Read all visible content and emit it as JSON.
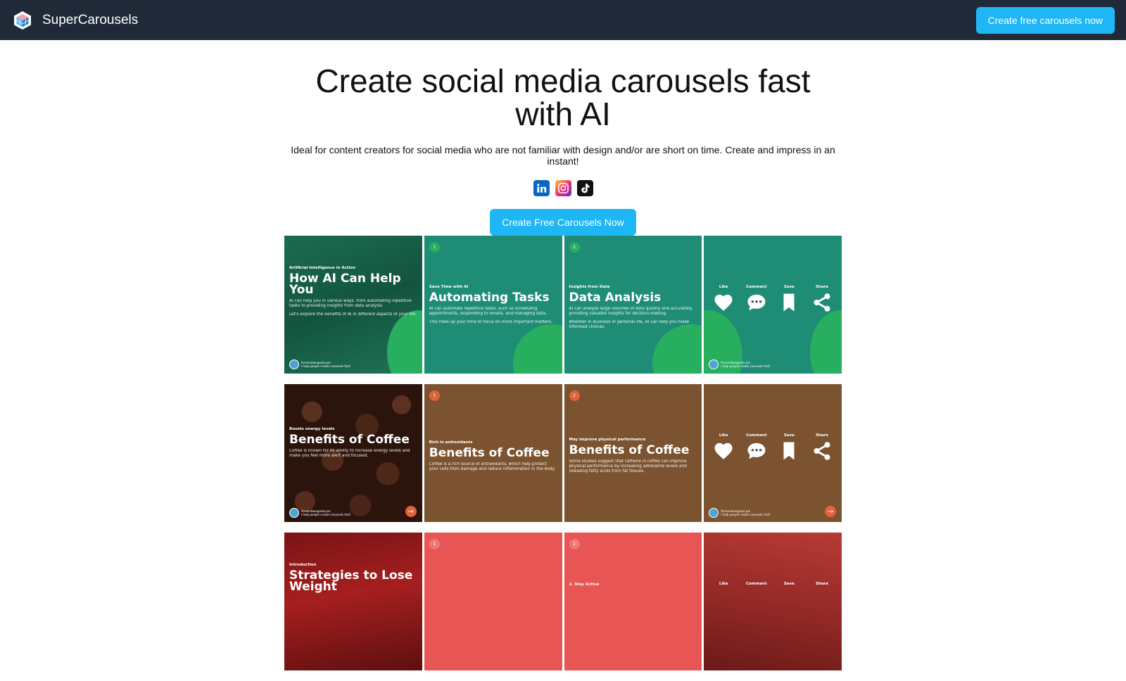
{
  "nav": {
    "brand": "SuperCarousels",
    "cta": "Create free carousels now"
  },
  "hero": {
    "title": "Create social media carousels fast with AI",
    "subtitle": "Ideal for content creators for social media who are not familiar with design and/or are short on time. Create and impress in an instant!",
    "cta": "Create Free Carousels Now",
    "socials": [
      "linkedin-icon",
      "instagram-icon",
      "tiktok-icon"
    ]
  },
  "colors": {
    "nav_bg": "#1f2937",
    "accent": "#1fb6f5",
    "green": "#1f8c76",
    "brown": "#7b5330",
    "red": "#e85555"
  },
  "actions": {
    "like": "Like",
    "comment": "Comment",
    "save": "Save",
    "share": "Share"
  },
  "footer": {
    "handle": "fernandoaugusto.pro",
    "tagline": "I help people create carousels fast!"
  },
  "carousels": [
    {
      "slides": [
        {
          "kicker": "Artificial Intelligence in Action",
          "title": "How AI Can Help You",
          "body1": "AI can help you in various ways, from automating repetitive tasks to providing insights from data analysis.",
          "body2": "Let's explore the benefits of AI in different aspects of your life."
        },
        {
          "num": "1",
          "kicker": "Save Time with AI",
          "title": "Automating Tasks",
          "body1": "AI can automate repetitive tasks, such as scheduling appointments, responding to emails, and managing data.",
          "body2": "This frees up your time to focus on more important matters."
        },
        {
          "num": "2",
          "kicker": "Insights from Data",
          "title": "Data Analysis",
          "body1": "AI can analyze large volumes of data quickly and accurately, providing valuable insights for decision-making.",
          "body2": "Whether in business or personal life, AI can help you make informed choices."
        },
        {
          "type": "actions"
        }
      ]
    },
    {
      "slides": [
        {
          "kicker": "Boosts energy levels",
          "title": "Benefits of Coffee",
          "body1": "Coffee is known for its ability to increase energy levels and make you feel more alert and focused."
        },
        {
          "num": "1",
          "kicker": "Rich in antioxidants",
          "title": "Benefits of Coffee",
          "body1": "Coffee is a rich source of antioxidants, which help protect your cells from damage and reduce inflammation in the body."
        },
        {
          "num": "2",
          "kicker": "May improve physical performance",
          "title": "Benefits of Coffee",
          "body1": "Some studies suggest that caffeine in coffee can improve physical performance by increasing adrenaline levels and releasing fatty acids from fat tissues."
        },
        {
          "type": "actions"
        }
      ]
    },
    {
      "slides": [
        {
          "kicker": "Introduction",
          "title": "Strategies to Lose Weight"
        },
        {
          "num": "1"
        },
        {
          "num": "2",
          "kicker": "2. Stay Active"
        },
        {
          "type": "actions"
        }
      ]
    }
  ]
}
